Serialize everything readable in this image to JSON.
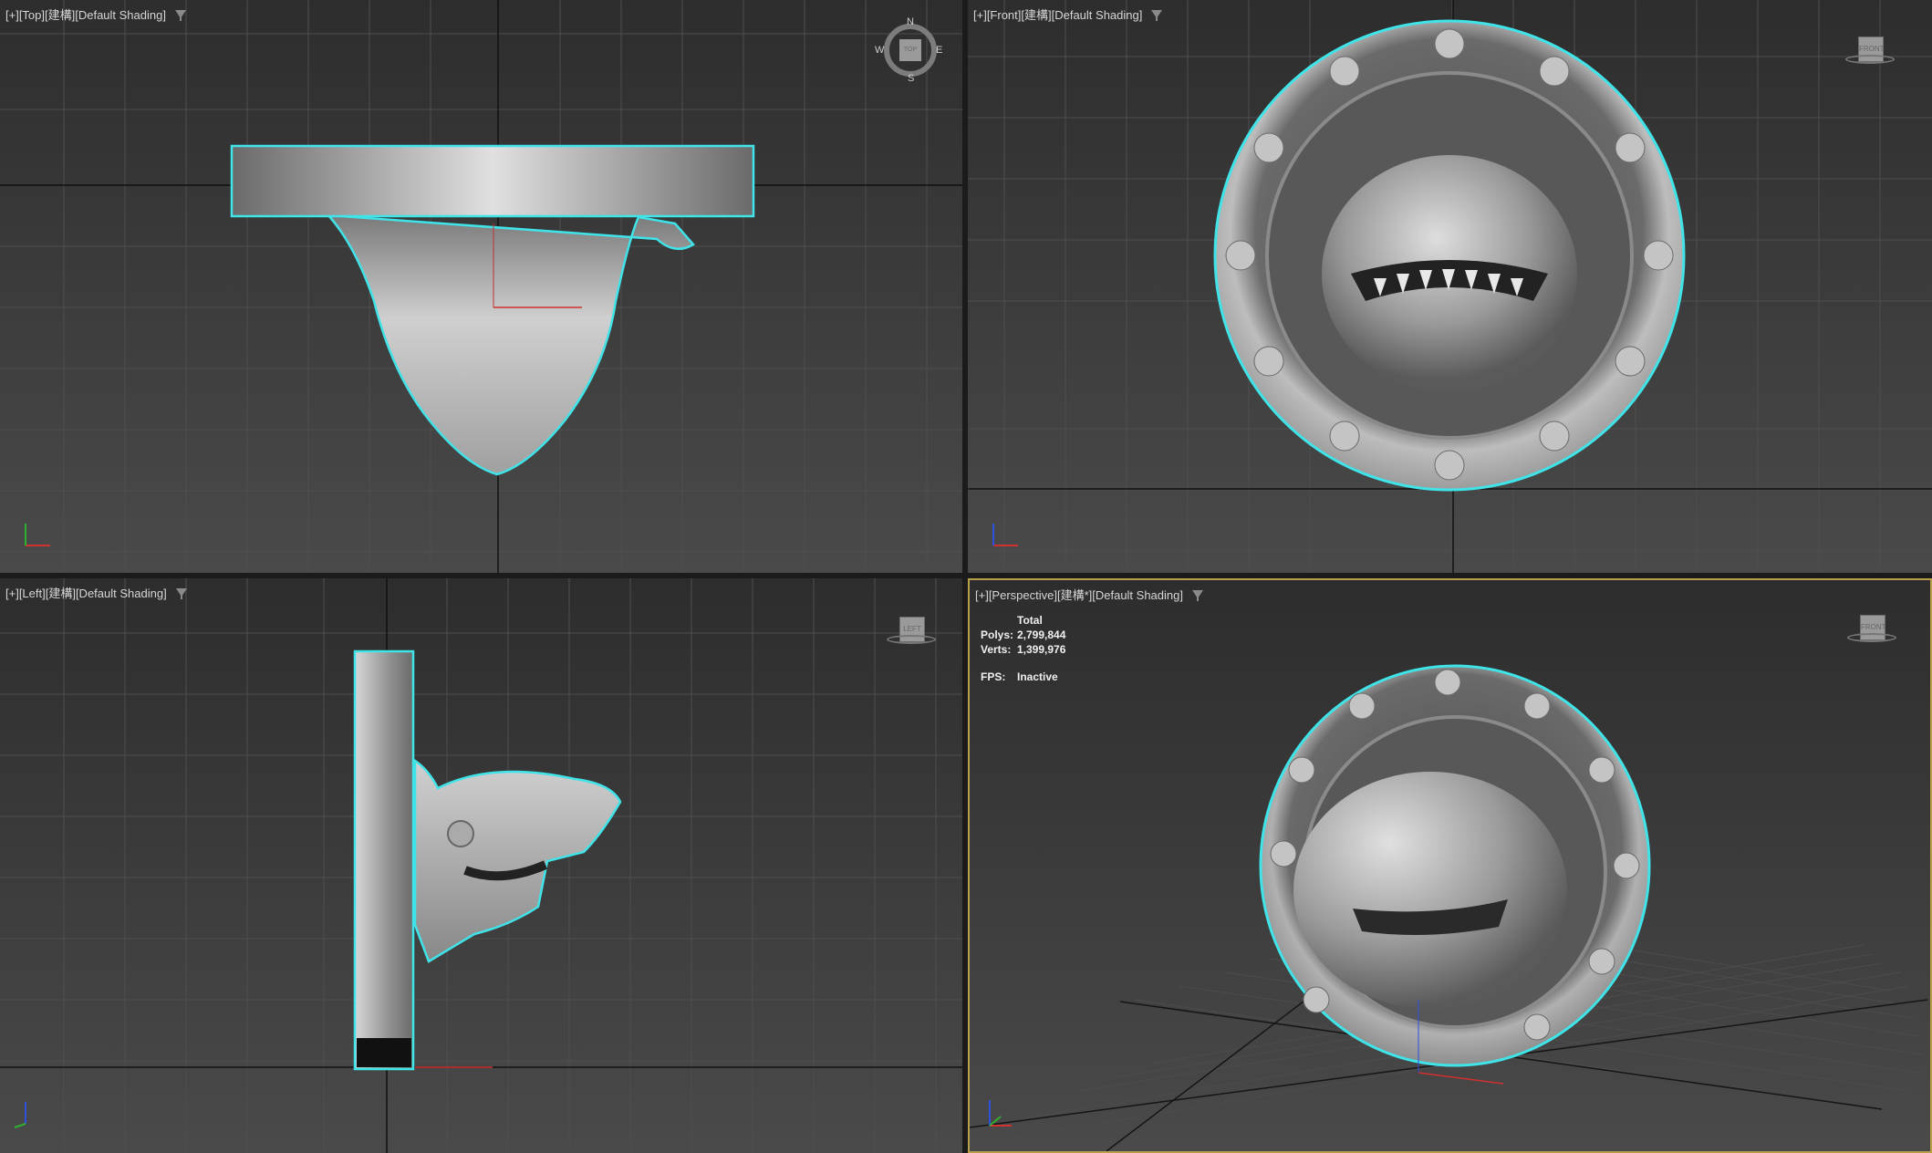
{
  "viewports": {
    "top": {
      "label": "[+][Top][建構][Default Shading]",
      "compass": {
        "n": "N",
        "s": "S",
        "e": "E",
        "w": "W",
        "cube": "TOP"
      }
    },
    "front": {
      "label": "[+][Front][建構][Default Shading]",
      "cube": "FRONT"
    },
    "left": {
      "label": "[+][Left][建構][Default Shading]",
      "cube": "LEFT"
    },
    "perspective": {
      "label": "[+][Perspective][建構*][Default Shading]",
      "cube": "FRONT",
      "stats": {
        "total_label": "Total",
        "polys_label": "Polys:",
        "polys_value": "2,799,844",
        "verts_label": "Verts:",
        "verts_value": "1,399,976",
        "fps_label": "FPS:",
        "fps_value": "Inactive"
      }
    }
  },
  "colors": {
    "selection_outline": "#3fe3e8",
    "active_border": "#b8a04a",
    "grid_line": "#5a5a5a",
    "axis_x": "#d03030",
    "axis_y": "#30b030",
    "axis_z": "#3050e0"
  }
}
